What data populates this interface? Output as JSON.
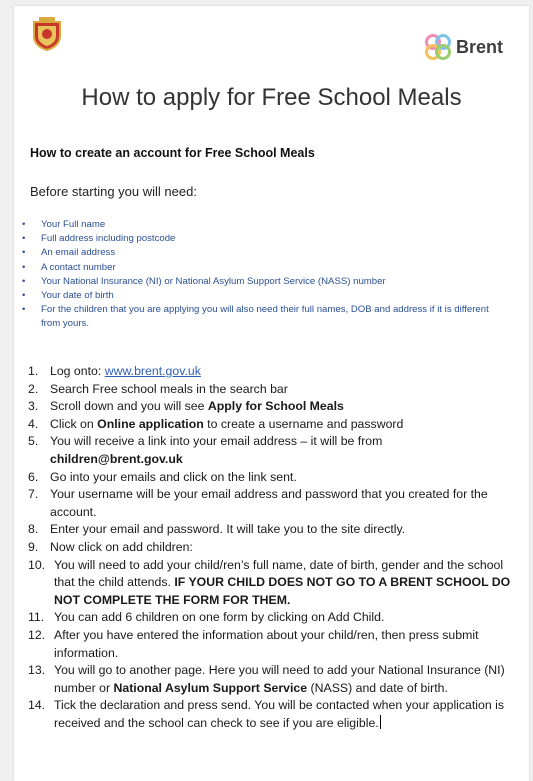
{
  "header": {
    "logo_text": "Brent"
  },
  "title": "How to apply for Free School Meals",
  "subheading": "How to create an account for Free School Meals",
  "before_text": "Before starting you will need:",
  "needs": [
    "Your Full name",
    "Full address including postcode",
    "An email address",
    "A contact number",
    "Your National Insurance (NI) or National Asylum Support Service (NASS) number",
    "Your date of birth",
    "For the children that you are applying you will also need their full names, DOB and address if it is different from yours."
  ],
  "steps": {
    "n1": "1.",
    "s1a": "Log onto: ",
    "s1link": "www.brent.gov.uk",
    "n2": "2.",
    "s2": "Search Free school meals in the search bar",
    "n3": "3.",
    "s3a": "Scroll down and you will see ",
    "s3b": "Apply for School Meals",
    "n4": "4.",
    "s4a": "Click on ",
    "s4b": "Online application",
    "s4c": " to create a username and password",
    "n5": "5.",
    "s5a": "You will receive a link into your email address – it will be from ",
    "s5b": "children@brent.gov.uk",
    "n6": "6.",
    "s6": "Go into your emails and click on the link sent.",
    "n7": "7.",
    "s7": "Your username will be your email address and password that you created for the account.",
    "n8": "8.",
    "s8": "Enter your email and password. It will take you to the site directly.",
    "n9": "9.",
    "s9": "Now click on add children:",
    "n10": "10.",
    "s10a": "You will need to add your child/ren’s full name, date of birth, gender and the school that the child attends. ",
    "s10b": "IF YOUR CHILD DOES NOT GO TO A BRENT SCHOOL DO NOT COMPLETE THE FORM FOR THEM.",
    "n11": "11.",
    "s11": "You can add 6 children on one form by clicking on Add Child.",
    "n12": "12.",
    "s12": "After you have entered the information about your child/ren, then press submit information.",
    "n13": "13.",
    "s13a": "You will go to another page. Here you will need to add your National Insurance (NI) number or ",
    "s13b": "National Asylum Support Service",
    "s13c": " (NASS) and date of birth.",
    "n14": "14.",
    "s14": "Tick the declaration and press send. You will be contacted when your application is received and the school can check to see if you are eligible."
  },
  "colors": {
    "link": "#2f5fb8",
    "bullets": "#2a4f95"
  }
}
